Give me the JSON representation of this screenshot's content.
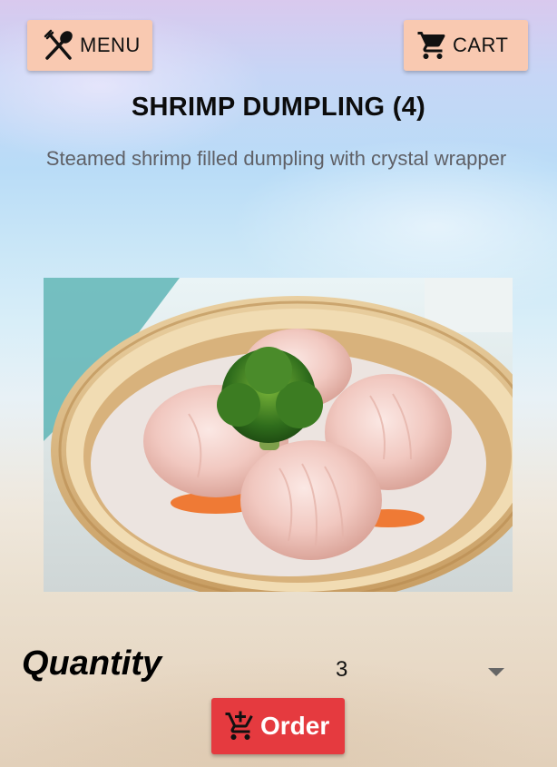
{
  "header": {
    "menu_label": "MENU",
    "menu_icon": "fork-spoon-icon",
    "cart_label": "CART",
    "cart_icon": "shopping-cart-icon"
  },
  "item": {
    "title": "SHRIMP DUMPLING (4)",
    "description": "Steamed shrimp filled dumpling with crystal wrapper",
    "image": "shrimp-dumplings-in-bamboo-steamer"
  },
  "quantity": {
    "label": "Quantity",
    "selected": "3"
  },
  "order": {
    "label": "Order",
    "icon": "add-to-cart-icon"
  },
  "colors": {
    "top_button_bg": "#f9c9b1",
    "order_button_bg": "#e53a3f"
  }
}
